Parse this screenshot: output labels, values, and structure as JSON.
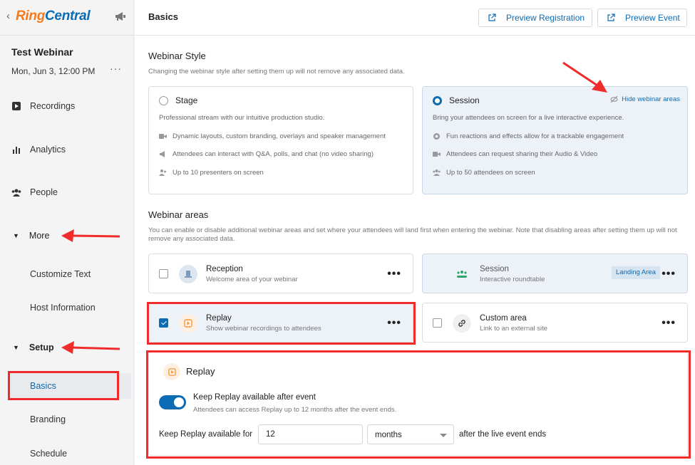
{
  "brand": {
    "ring": "Ring",
    "central": "Central"
  },
  "webinar": {
    "title": "Test Webinar",
    "date": "Mon, Jun 3, 12:00 PM",
    "more": "···"
  },
  "nav": {
    "recordings": "Recordings",
    "analytics": "Analytics",
    "people": "People",
    "more": "More",
    "customize_text": "Customize Text",
    "host_information": "Host Information",
    "setup": "Setup",
    "basics": "Basics",
    "branding": "Branding",
    "schedule": "Schedule"
  },
  "header": {
    "title": "Basics",
    "preview_registration": "Preview Registration",
    "preview_event": "Preview Event"
  },
  "style_section": {
    "title": "Webinar Style",
    "description": "Changing the webinar style after setting them up will not remove any associated data.",
    "stage": {
      "name": "Stage",
      "description": "Professional stream with our intuitive production studio.",
      "features": [
        "Dynamic layouts, custom branding, overlays and speaker management",
        "Attendees can interact with Q&A, polls, and chat (no video sharing)",
        "Up to 10 presenters on screen"
      ]
    },
    "session": {
      "name": "Session",
      "hide_link": "Hide webinar areas",
      "description": "Bring your attendees on screen for a live interactive experience.",
      "features": [
        "Fun reactions and effects allow for a trackable engagement",
        "Attendees can request sharing their Audio & Video",
        "Up to 50 attendees on screen"
      ]
    }
  },
  "areas_section": {
    "title": "Webinar areas",
    "description": "You can enable or disable additional webinar areas and set where your attendees will land first when entering the webinar. Note that disabling areas after setting them up will not remove any associated data.",
    "reception": {
      "name": "Reception",
      "sub": "Welcome area of your webinar"
    },
    "session": {
      "name": "Session",
      "sub": "Interactive roundtable",
      "badge": "Landing Area"
    },
    "replay": {
      "name": "Replay",
      "sub": "Show webinar recordings to attendees"
    },
    "custom": {
      "name": "Custom area",
      "sub": "Link to an external site"
    },
    "kebab": "•••"
  },
  "replay_panel": {
    "title": "Replay",
    "toggle_label": "Keep Replay available after event",
    "toggle_sub": "Attendees can access Replay up to 12 months after the event ends.",
    "keep_label": "Keep Replay available for",
    "amount": "12",
    "unit": "months",
    "after_label": "after the live event ends"
  },
  "colors": {
    "accent": "#0b6bb3",
    "brand_orange": "#f47b20",
    "annotation_red": "#ef2b2b"
  }
}
